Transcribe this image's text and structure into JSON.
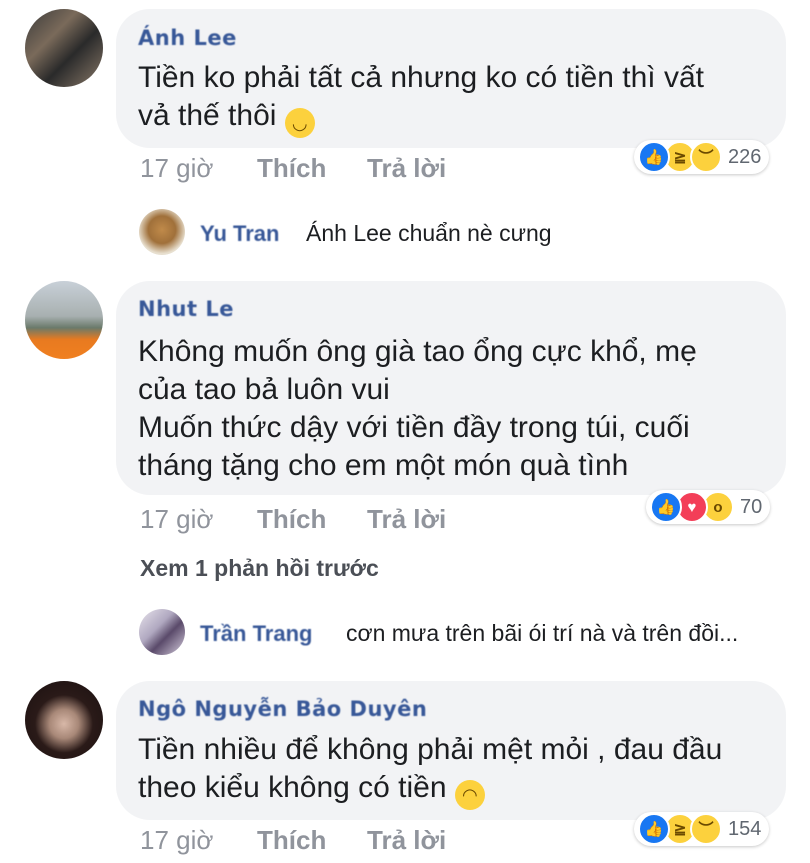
{
  "comments": [
    {
      "author": "Ánh Lee",
      "text_line1": "Tiền ko phải tất cả nhưng ko có tiền thì vất",
      "text_line2": "vả thế thôi",
      "emoji_icon": "relieved-face-icon",
      "time": "17 giờ",
      "like": "Thích",
      "reply": "Trả lời",
      "reactions": [
        "like",
        "haha",
        "sad"
      ],
      "reaction_count": "226",
      "reply_preview": {
        "name": "Yu Tran",
        "text": "Ánh Lee chuẩn nè cưng"
      }
    },
    {
      "author": "Nhut Le",
      "lines": [
        "Không muốn ông già tao ổng cực khổ, mẹ",
        "của tao bả luôn vui",
        "Muốn thức dậy với tiền đầy trong túi, cuối",
        "tháng tặng cho em một món quà tình"
      ],
      "time": "17 giờ",
      "like": "Thích",
      "reply": "Trả lời",
      "reactions": [
        "like",
        "love",
        "wow"
      ],
      "reaction_count": "70",
      "view_previous": "Xem 1 phản hồi trước",
      "reply_preview": {
        "name": "Trần Trang",
        "text": "cơn mưa trên bãi ói trí nà và trên đồi..."
      }
    },
    {
      "author": "Ngô Nguyễn Bảo Duyên",
      "text_line1": "Tiền nhiều để không phải mệt mỏi , đau đầu",
      "text_line2": "theo kiểu không có tiền",
      "emoji_icon": "upside-down-face-icon",
      "time": "17 giờ",
      "like": "Thích",
      "reply": "Trả lời",
      "reactions": [
        "like",
        "haha",
        "sad"
      ],
      "reaction_count": "154"
    }
  ],
  "colors": {
    "link": "#385898",
    "meta": "#90949c",
    "bubble": "#f2f3f5",
    "like": "#1877f2",
    "love": "#f33e58",
    "emoji": "#fcd13d"
  }
}
